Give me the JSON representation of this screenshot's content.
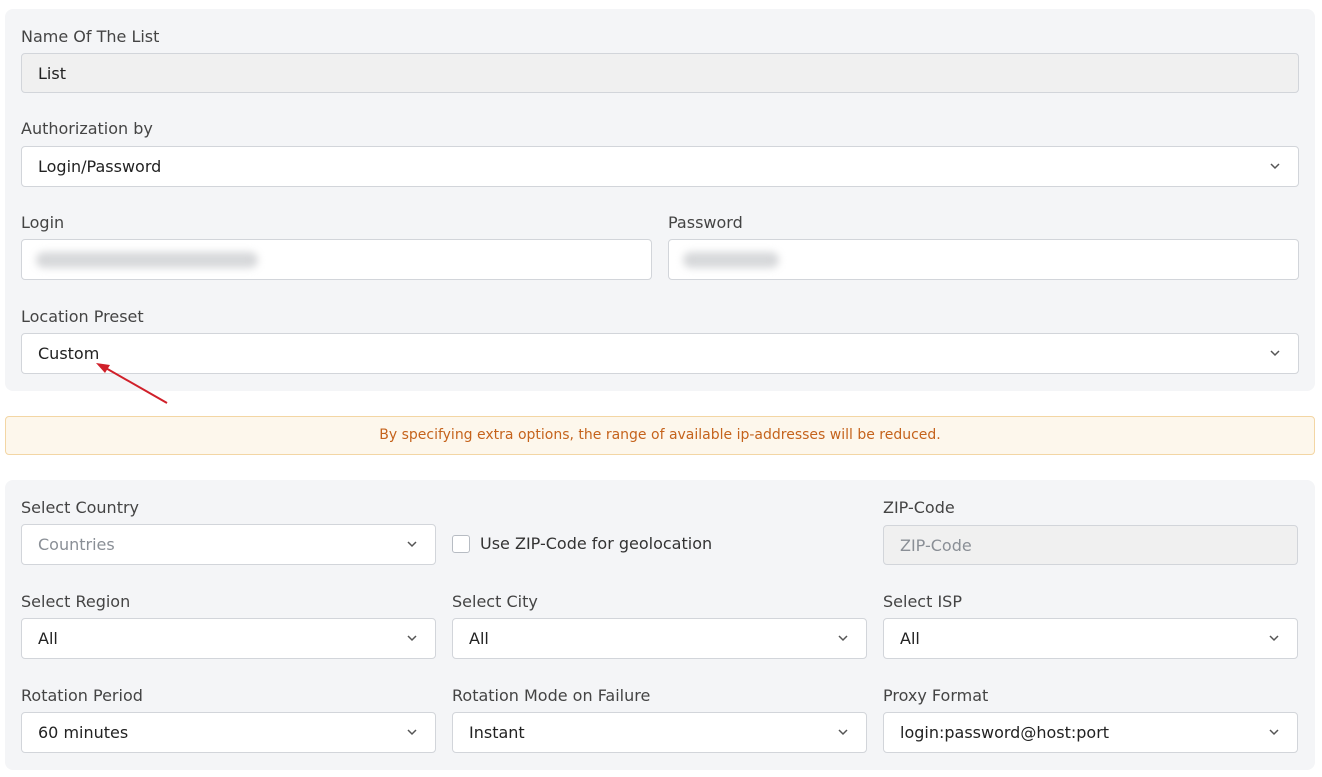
{
  "list_name": {
    "label": "Name Of The List",
    "value": "List"
  },
  "authorization": {
    "label": "Authorization by",
    "value": "Login/Password"
  },
  "login": {
    "label": "Login"
  },
  "password": {
    "label": "Password"
  },
  "location_preset": {
    "label": "Location Preset",
    "value": "Custom"
  },
  "alert": {
    "text": "By specifying extra options, the range of available ip-addresses will be reduced."
  },
  "country": {
    "label": "Select Country",
    "placeholder": "Countries"
  },
  "zip_toggle": {
    "label": "Use ZIP-Code for geolocation",
    "checked": false
  },
  "zip": {
    "label": "ZIP-Code",
    "placeholder": "ZIP-Code"
  },
  "region": {
    "label": "Select Region",
    "value": "All"
  },
  "city": {
    "label": "Select City",
    "value": "All"
  },
  "isp": {
    "label": "Select ISP",
    "value": "All"
  },
  "rotation_period": {
    "label": "Rotation Period",
    "value": "60 minutes"
  },
  "rotation_mode": {
    "label": "Rotation Mode on Failure",
    "value": "Instant"
  },
  "proxy_format": {
    "label": "Proxy Format",
    "value": "login:password@host:port"
  },
  "colors": {
    "panel_bg": "#f4f5f7",
    "alert_bg": "#fdf7ec",
    "alert_text": "#c5631c",
    "annotation_arrow": "#d0202a"
  },
  "icons": {
    "dropdown": "chevron-down-icon",
    "annotation": "red-arrow-annotation"
  }
}
